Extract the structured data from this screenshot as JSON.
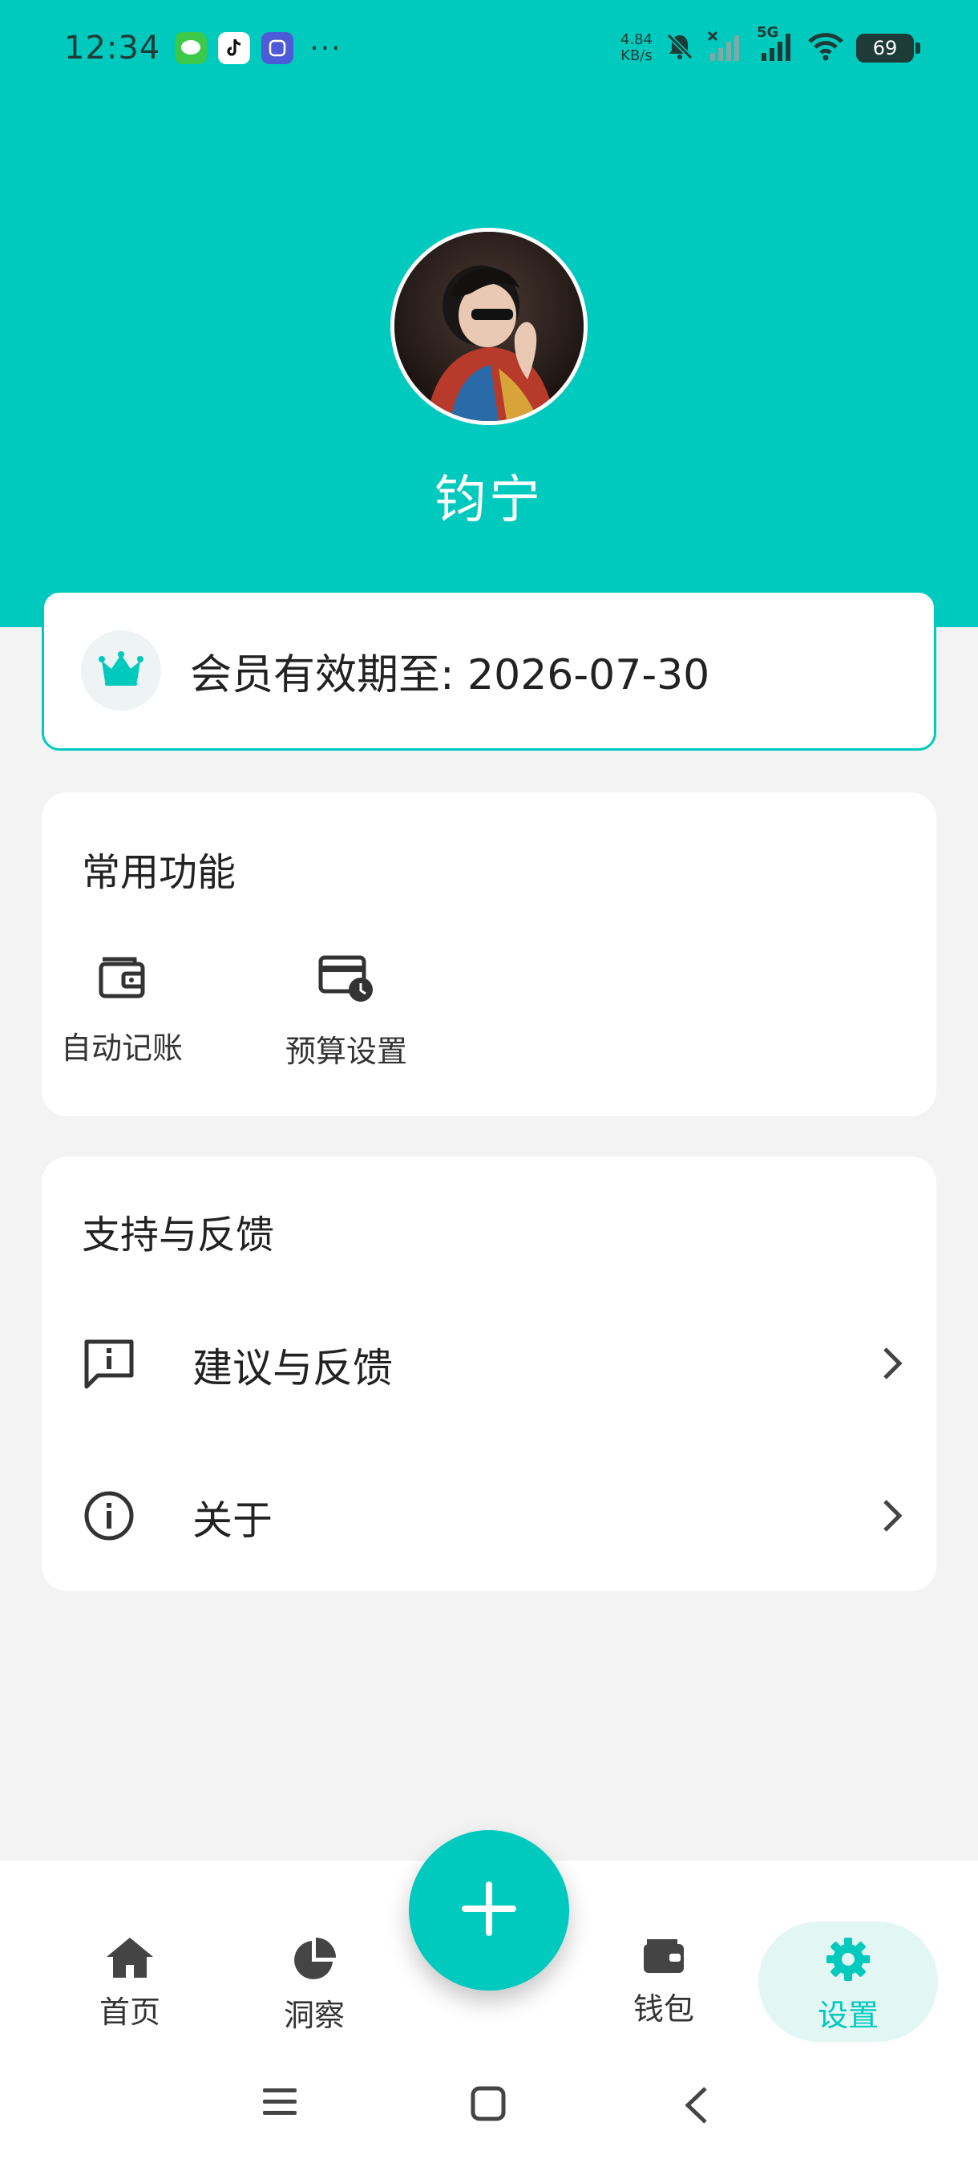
{
  "status_bar": {
    "time": "12:34",
    "app_icons": [
      "message-icon",
      "tiktok-icon",
      "tieba-icon"
    ],
    "more": "···",
    "speed_value": "4.84",
    "speed_unit": "KB/s",
    "network": "5G",
    "battery": "69"
  },
  "profile": {
    "username": "钧宁"
  },
  "membership": {
    "text": "会员有效期至: 2026-07-30"
  },
  "common_functions": {
    "title": "常用功能",
    "items": [
      {
        "label": "自动记账",
        "icon": "wallet-icon"
      },
      {
        "label": "预算设置",
        "icon": "budget-clock-icon"
      }
    ]
  },
  "support": {
    "title": "支持与反馈",
    "items": [
      {
        "label": "建议与反馈",
        "icon": "feedback-icon"
      },
      {
        "label": "关于",
        "icon": "info-icon"
      }
    ]
  },
  "bottom_nav": {
    "items": [
      {
        "label": "首页",
        "icon": "home-icon"
      },
      {
        "label": "洞察",
        "icon": "pie-chart-icon"
      },
      {
        "label": "钱包",
        "icon": "wallet-icon"
      },
      {
        "label": "设置",
        "icon": "gear-icon",
        "active": true
      }
    ],
    "add_button": "plus-icon"
  },
  "colors": {
    "accent": "#00c9bd",
    "background": "#f3f3f3",
    "active_pill": "#e2f6f4"
  }
}
